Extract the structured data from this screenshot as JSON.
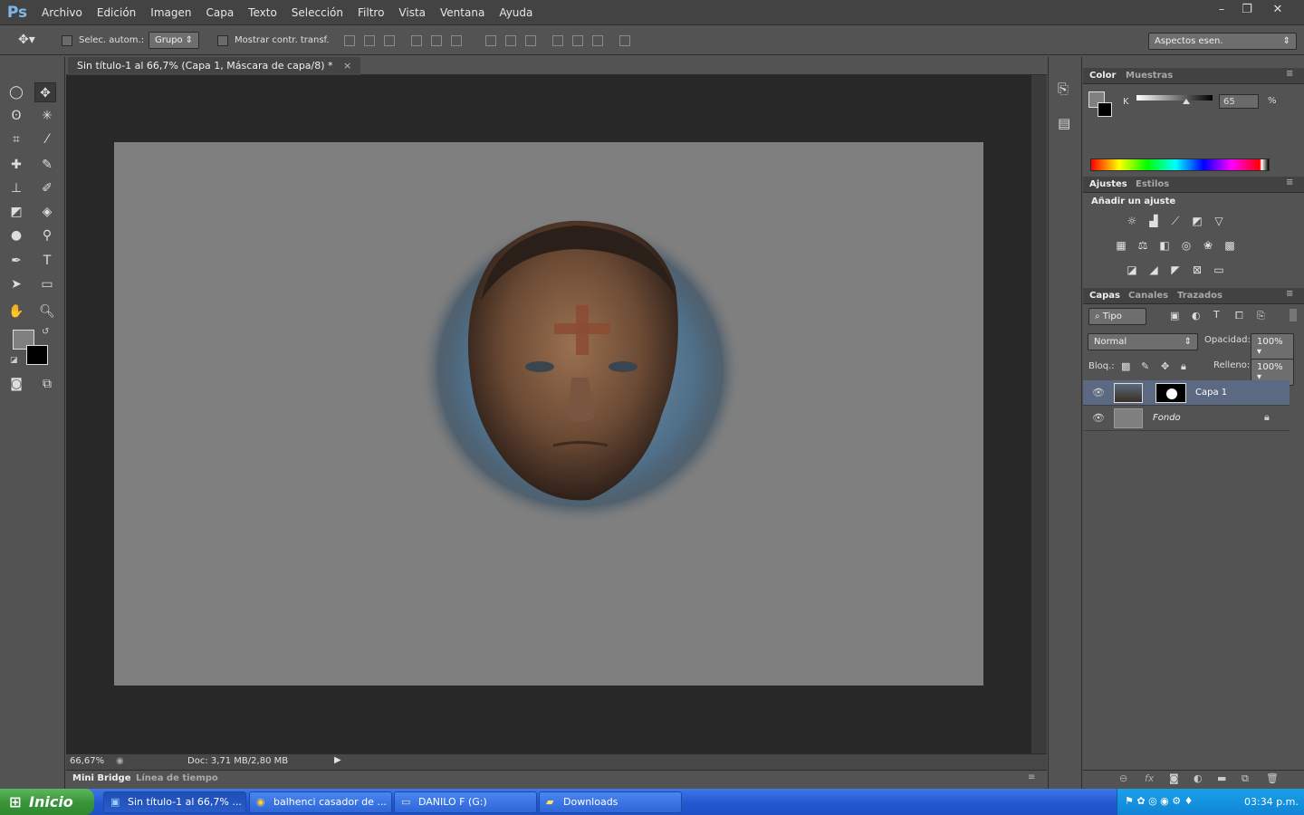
{
  "app": {
    "logo": "Ps",
    "window_buttons": [
      "–",
      "❐",
      "✕"
    ]
  },
  "menu": [
    "Archivo",
    "Edición",
    "Imagen",
    "Capa",
    "Texto",
    "Selección",
    "Filtro",
    "Vista",
    "Ventana",
    "Ayuda"
  ],
  "options": {
    "auto_select_label": "Selec. autom.:",
    "auto_select_target": "Grupo",
    "show_transform_label": "Mostrar contr. transf.",
    "workspace": "Aspectos esen."
  },
  "document": {
    "tab_title": "Sin título-1 al 66,7% (Capa 1, Máscara de capa/8) *",
    "zoom": "66,67%",
    "doc_info": "Doc: 3,71 MB/2,80 MB"
  },
  "bottom_tabs": [
    "Mini Bridge",
    "Línea de tiempo"
  ],
  "color_panel": {
    "tabs": [
      "Color",
      "Muestras"
    ],
    "channel": "K",
    "value": "65",
    "unit": "%",
    "slider_fraction": 0.65
  },
  "adjustments_panel": {
    "tabs": [
      "Ajustes",
      "Estilos"
    ],
    "heading": "Añadir un ajuste"
  },
  "layers_panel": {
    "tabs": [
      "Capas",
      "Canales",
      "Trazados"
    ],
    "filter_kind": "Tipo",
    "blend_mode": "Normal",
    "opacity_label": "Opacidad:",
    "opacity": "100%",
    "lock_label": "Bloq.:",
    "fill_label": "Relleno:",
    "fill": "100%",
    "layers": [
      {
        "name": "Capa 1",
        "selected": true
      },
      {
        "name": "Fondo",
        "locked": true
      }
    ]
  },
  "taskbar": {
    "start": "Inicio",
    "tasks": [
      "Sin título-1 al 66,7% ...",
      "balhenci casador de ...",
      "DANILO F (G:)",
      "Downloads"
    ],
    "clock": "03:34 p.m."
  },
  "colors": {
    "canvas": "#7f7f7f",
    "workspace": "#282828",
    "panel": "#535353",
    "selected_layer": "#5b6a82"
  }
}
